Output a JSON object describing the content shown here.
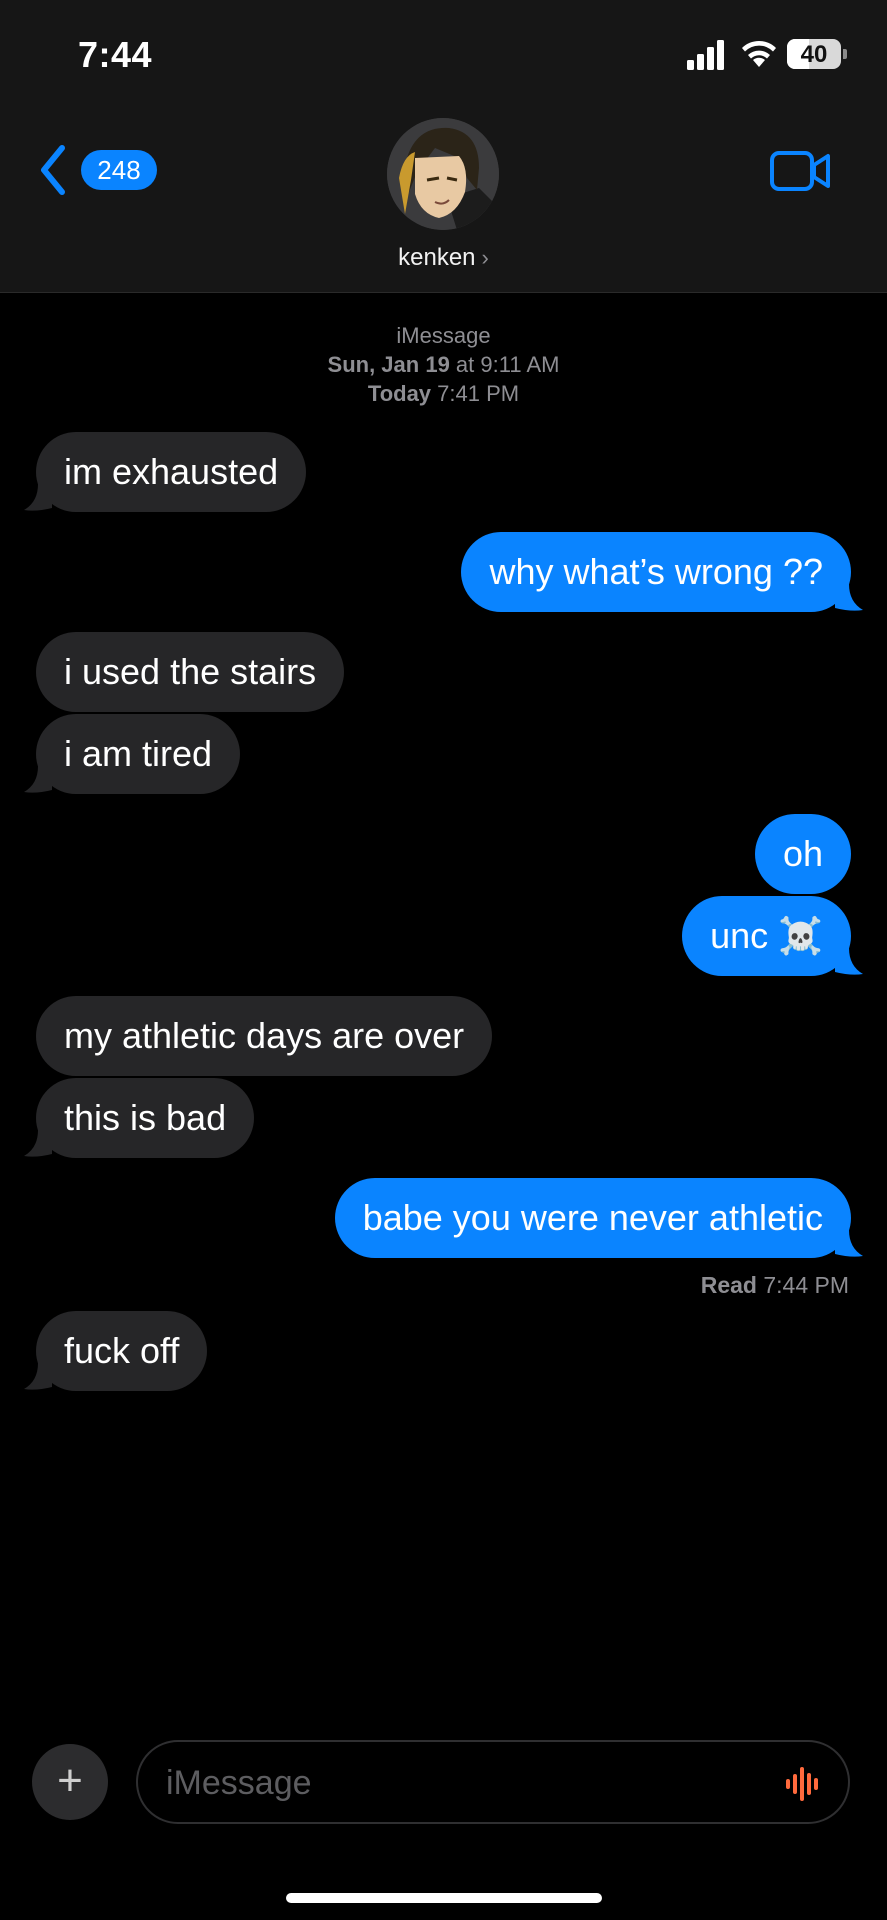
{
  "status_bar": {
    "time": "7:44",
    "battery": "40",
    "battery_level": 0.4
  },
  "header": {
    "back_count": "248",
    "contact_name": "kenken",
    "contact_chevron": "›"
  },
  "thread": {
    "service": "iMessage",
    "first_date_bold": "Sun, Jan 19",
    "first_date_rest": " at 9:11 AM",
    "today_bold": "Today",
    "today_rest": " 7:41 PM",
    "messages": [
      {
        "from": "them",
        "text": "im exhausted"
      },
      {
        "from": "me",
        "text": "why what’s wrong ??"
      },
      {
        "from": "them",
        "text": "i used the stairs"
      },
      {
        "from": "them",
        "text": "i am tired"
      },
      {
        "from": "me",
        "text": "oh"
      },
      {
        "from": "me",
        "text": "unc ☠️"
      },
      {
        "from": "them",
        "text": "my athletic days are over"
      },
      {
        "from": "them",
        "text": "this is bad"
      },
      {
        "from": "me",
        "text": "babe you were never athletic"
      },
      {
        "from": "them",
        "text": "fuck off"
      }
    ],
    "read_label": "Read",
    "read_time": " 7:44 PM"
  },
  "composer": {
    "placeholder": "iMessage",
    "plus": "+"
  },
  "colors": {
    "accent": "#0a84ff",
    "incoming": "#262628",
    "mic": "#ff6a3d"
  }
}
